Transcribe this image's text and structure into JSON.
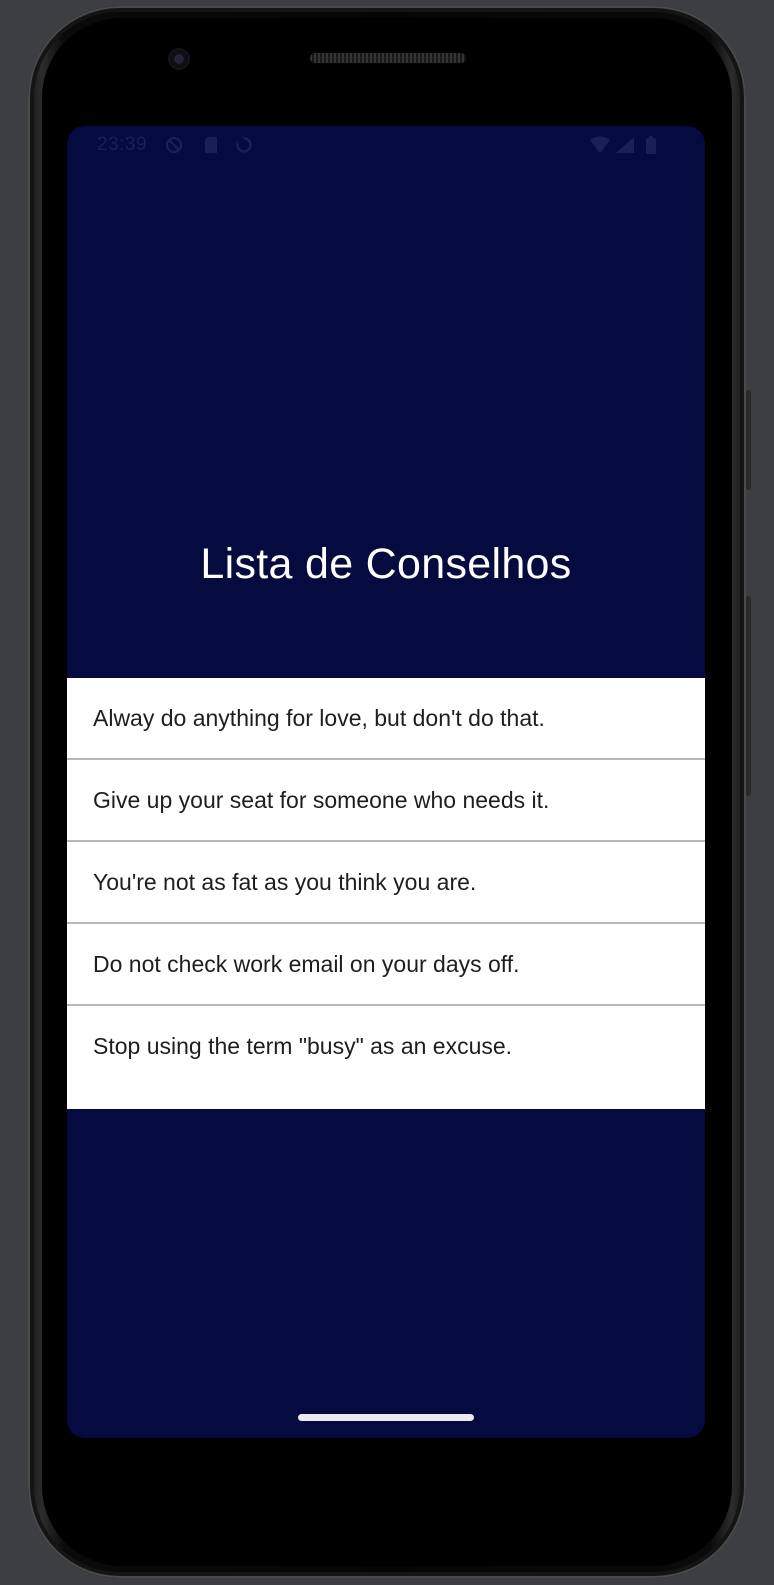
{
  "status_bar": {
    "time": "23:39",
    "icons": [
      "do-not-disturb-icon",
      "sd-card-icon",
      "sync-icon",
      "wifi-icon",
      "signal-icon",
      "battery-icon"
    ]
  },
  "app": {
    "title": "Lista de Conselhos",
    "background_color": "#050a3f",
    "list_background": "#ffffff",
    "divider_color": "#b9b9b9"
  },
  "advice_list": [
    {
      "text": "Alway do anything for love, but don't do that."
    },
    {
      "text": "Give up your seat for someone who needs it."
    },
    {
      "text": "You're not as fat as you think you are."
    },
    {
      "text": "Do not check work email on your days off."
    },
    {
      "text": "Stop using the term \"busy\" as an excuse."
    }
  ]
}
